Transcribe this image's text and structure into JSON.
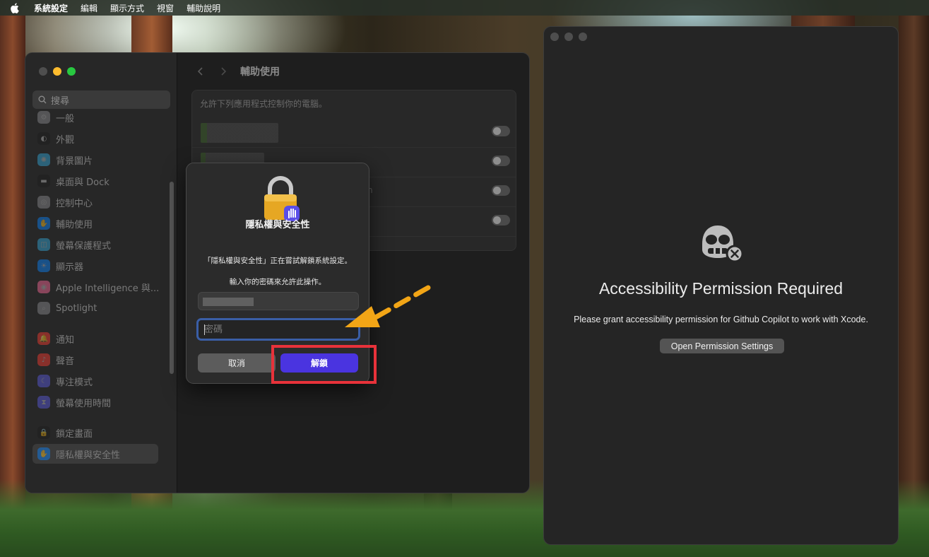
{
  "menubar": {
    "app_name": "系統設定",
    "items": [
      "編輯",
      "顯示方式",
      "視窗",
      "輔助說明"
    ]
  },
  "settings": {
    "search_placeholder": "搜尋",
    "title": "輔助使用",
    "panel_header": "允許下列應用程式控制你的電腦。",
    "sidebar_items": [
      {
        "label": "一般",
        "icon": "gear-icon",
        "color": "#8e8e93"
      },
      {
        "label": "外觀",
        "icon": "appearance-icon",
        "color": "#1c1c1e"
      },
      {
        "label": "背景圖片",
        "icon": "wallpaper-icon",
        "color": "#34aadc"
      },
      {
        "label": "桌面與 Dock",
        "icon": "dock-icon",
        "color": "#1c1c1e"
      },
      {
        "label": "控制中心",
        "icon": "control-center-icon",
        "color": "#8e8e93"
      },
      {
        "label": "輔助使用",
        "icon": "accessibility-icon",
        "color": "#0a84ff"
      },
      {
        "label": "螢幕保護程式",
        "icon": "screensaver-icon",
        "color": "#34aadc"
      },
      {
        "label": "顯示器",
        "icon": "display-icon",
        "color": "#0a84ff"
      },
      {
        "label": "Apple Intelligence 與...",
        "icon": "apple-intelligence-icon",
        "color": "#ff6b9a"
      },
      {
        "label": "Spotlight",
        "icon": "spotlight-icon",
        "color": "#8e8e93"
      },
      {
        "label": "通知",
        "icon": "notifications-icon",
        "color": "#ff3b30"
      },
      {
        "label": "聲音",
        "icon": "sound-icon",
        "color": "#ff3b30"
      },
      {
        "label": "專注模式",
        "icon": "focus-icon",
        "color": "#5e5ce6"
      },
      {
        "label": "螢幕使用時間",
        "icon": "screen-time-icon",
        "color": "#5e5ce6"
      },
      {
        "label": "鎖定畫面",
        "icon": "lock-screen-icon",
        "color": "#1c1c1e"
      },
      {
        "label": "隱私權與安全性",
        "icon": "privacy-hand-icon",
        "color": "#0a84ff"
      }
    ],
    "partial_row_label": "n"
  },
  "dialog": {
    "title": "隱私權與安全性",
    "message": "「隱私權與安全性」正在嘗試解鎖系統設定。",
    "prompt": "輸入你的密碼來允許此操作。",
    "password_placeholder": "密碼",
    "cancel_label": "取消",
    "unlock_label": "解鎖"
  },
  "copilot": {
    "title": "Accessibility Permission Required",
    "message": "Please grant accessibility permission for Github Copilot to work with Xcode.",
    "button_label": "Open Permission Settings"
  },
  "colors": {
    "unlock_accent": "#4a34e0",
    "highlight": "#e8323a",
    "arrow": "#f2a516",
    "traffic_red": "#ff5f57",
    "traffic_yellow": "#febc2e",
    "traffic_green": "#28c840"
  }
}
